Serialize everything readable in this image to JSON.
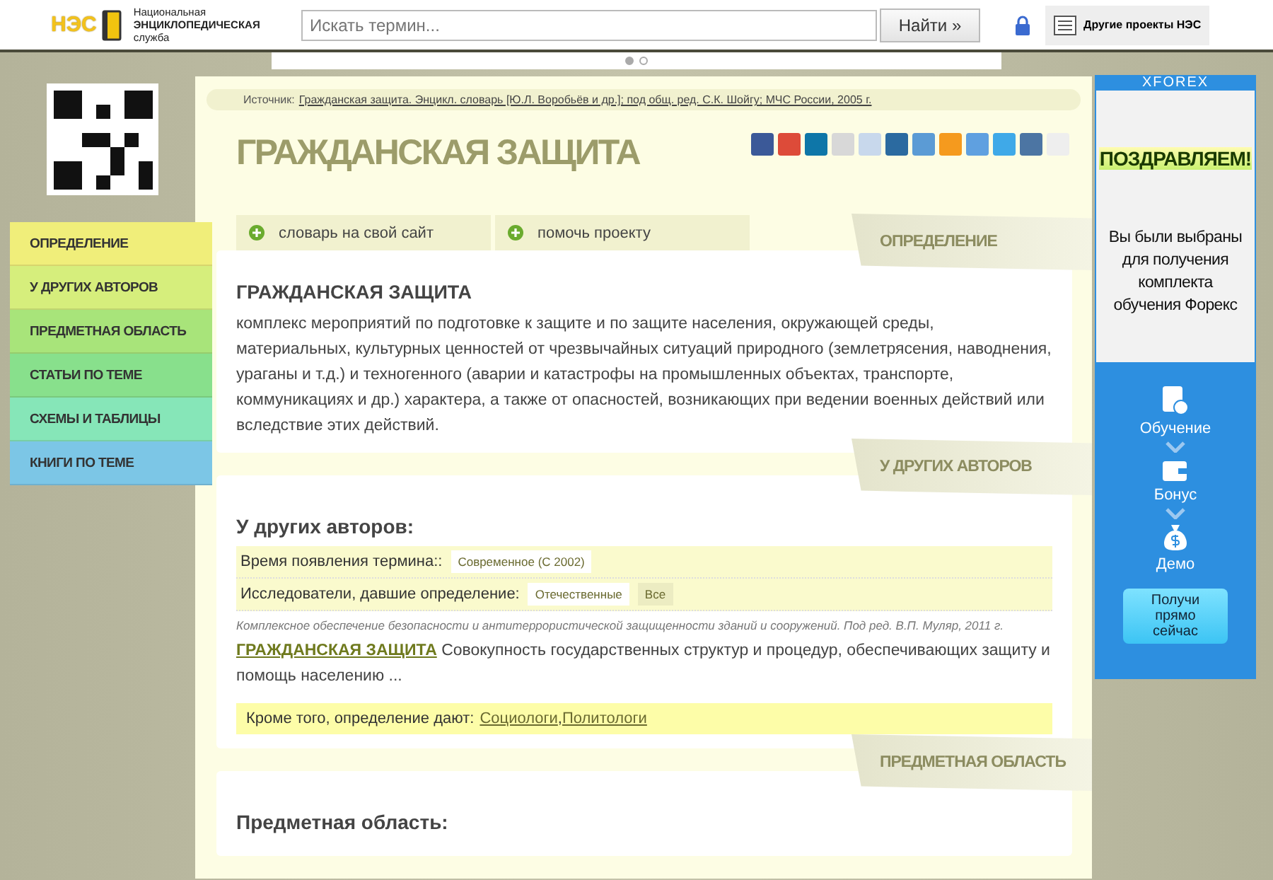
{
  "header": {
    "logo": "НЭС",
    "logo_caption": [
      "Национальная",
      "ЭНЦИКЛОПЕДИЧЕСКАЯ",
      "служба"
    ],
    "search": {
      "placeholder": "Искать термин..."
    },
    "search_button": "Найти »",
    "projects_button": "Другие проекты НЭС"
  },
  "carousel": {
    "dots": [
      {
        "selected": true
      },
      {
        "selected": false
      }
    ]
  },
  "sidebar": {
    "items": [
      {
        "label": "ОПРЕДЕЛЕНИЕ",
        "color": "#f0ee7a"
      },
      {
        "label": "У ДРУГИХ АВТОРОВ",
        "color": "#d6ee7c"
      },
      {
        "label": "ПРЕДМЕТНАЯ ОБЛАСТЬ",
        "color": "#a8e47a"
      },
      {
        "label": "СТАТЬИ ПО ТЕМЕ",
        "color": "#88e08c"
      },
      {
        "label": "СХЕМЫ И ТАБЛИЦЫ",
        "color": "#86e6b8"
      },
      {
        "label": "КНИГИ ПО ТЕМЕ",
        "color": "#7cc6e6"
      }
    ]
  },
  "source": {
    "label": "Источник:",
    "link": "Гражданская защита. Энцикл. словарь [Ю.Л. Воробьёв и др.]; под общ. ред. С.К. Шойгу; МЧС России, 2005 г."
  },
  "title": "ГРАЖДАНСКАЯ ЗАЩИТА",
  "share_icons": [
    {
      "color": "#3b5998"
    },
    {
      "color": "#dd4b39"
    },
    {
      "color": "#0e76a8"
    },
    {
      "color": "#d8d8d8"
    },
    {
      "color": "#c8d8ec"
    },
    {
      "color": "#2b6aa0"
    },
    {
      "color": "#5b9bd5"
    },
    {
      "color": "#f59a1e"
    },
    {
      "color": "#5fa0e0"
    },
    {
      "color": "#3fa9e8"
    },
    {
      "color": "#4c75a3"
    },
    {
      "color": "#eeeeee"
    }
  ],
  "tabs": [
    {
      "label": "словарь на свой сайт"
    },
    {
      "label": "помочь проекту"
    }
  ],
  "sections": [
    {
      "ribbon": "ОПРЕДЕЛЕНИЕ",
      "heading": "ГРАЖДАНСКАЯ ЗАЩИТА",
      "text": "комплекс мероприятий по подготовке к защите и по защите населения, окружающей среды, материальных, культурных ценностей от чрезвычайных ситуаций природного (землетрясения, наводнения, ураганы и т.д.) и техногенного (аварии и катастрофы на промышленных объектах, транспорте, коммуникациях и др.) характера, а также от опасностей, возникающих при ведении военных действий или вследствие этих действий."
    },
    {
      "ribbon": "У ДРУГИХ АВТОРОВ",
      "heading": "У других авторов:",
      "filters": [
        {
          "label": "Время появления термина::",
          "options": [
            {
              "label": "Современное (С 2002)",
              "selected": false
            }
          ]
        },
        {
          "label": "Исследователи, давшие определение:",
          "options": [
            {
              "label": "Отечественные",
              "selected": false
            },
            {
              "label": "Все",
              "selected": true
            }
          ]
        }
      ],
      "citation": "Комплексное обеспечение безопасности и антитеррористической защищенности зданий и сооружений. Под ред. В.П. Муляр, 2011 г.",
      "term": "ГРАЖДАНСКАЯ ЗАЩИТА",
      "term_text": "Совокупность государственных структур и процедур, обеспечивающих защиту и помощь населению ...",
      "also_label": "Кроме того, определение дают:",
      "also_links": [
        "Социологи",
        "Политологи"
      ],
      "separator": ","
    },
    {
      "ribbon": "ПРЕДМЕТНАЯ ОБЛАСТЬ",
      "heading": "Предметная область:"
    }
  ],
  "ad": {
    "brand": "XFOREX",
    "headline": "ПОЗДРАВЛЯЕМ!",
    "text": "Вы были выбраны для получения комплекта обучения Форекс",
    "steps": [
      {
        "kind": "book",
        "label": "Обучение"
      },
      {
        "kind": "wallet",
        "label": "Бонус"
      },
      {
        "kind": "bag",
        "label": "Демо"
      }
    ],
    "cta": "Получи прямо сейчас"
  }
}
